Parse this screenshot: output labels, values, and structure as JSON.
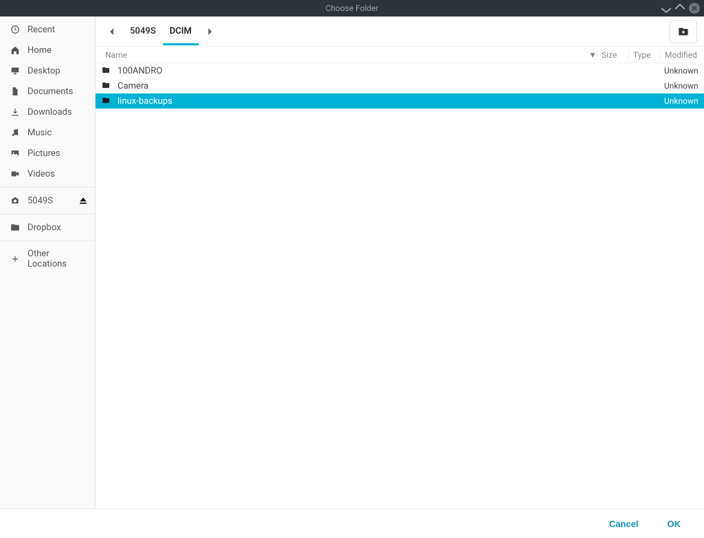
{
  "window": {
    "title": "Choose Folder"
  },
  "sidebar": {
    "groups": [
      [
        {
          "icon": "clock",
          "label": "Recent"
        },
        {
          "icon": "home",
          "label": "Home"
        },
        {
          "icon": "desktop",
          "label": "Desktop"
        },
        {
          "icon": "doc",
          "label": "Documents"
        },
        {
          "icon": "download",
          "label": "Downloads"
        },
        {
          "icon": "music",
          "label": "Music"
        },
        {
          "icon": "picture",
          "label": "Pictures"
        },
        {
          "icon": "video",
          "label": "Videos"
        }
      ],
      [
        {
          "icon": "camera",
          "label": "5049S",
          "ejectable": true
        }
      ],
      [
        {
          "icon": "folder",
          "label": "Dropbox"
        }
      ],
      [
        {
          "icon": "plus",
          "label": "Other Locations"
        }
      ]
    ]
  },
  "path": {
    "segments": [
      "5049S",
      "DCIM"
    ],
    "active_index": 1
  },
  "columns": {
    "name": "Name",
    "size": "Size",
    "type": "Type",
    "modified": "Modified",
    "sort_glyph": "▼"
  },
  "files": [
    {
      "name": "100ANDRO",
      "size": "",
      "type": "",
      "modified": "Unknown",
      "selected": false
    },
    {
      "name": "Camera",
      "size": "",
      "type": "",
      "modified": "Unknown",
      "selected": false
    },
    {
      "name": "linux-backups",
      "size": "",
      "type": "",
      "modified": "Unknown",
      "selected": true
    }
  ],
  "footer": {
    "cancel": "Cancel",
    "ok": "OK"
  }
}
